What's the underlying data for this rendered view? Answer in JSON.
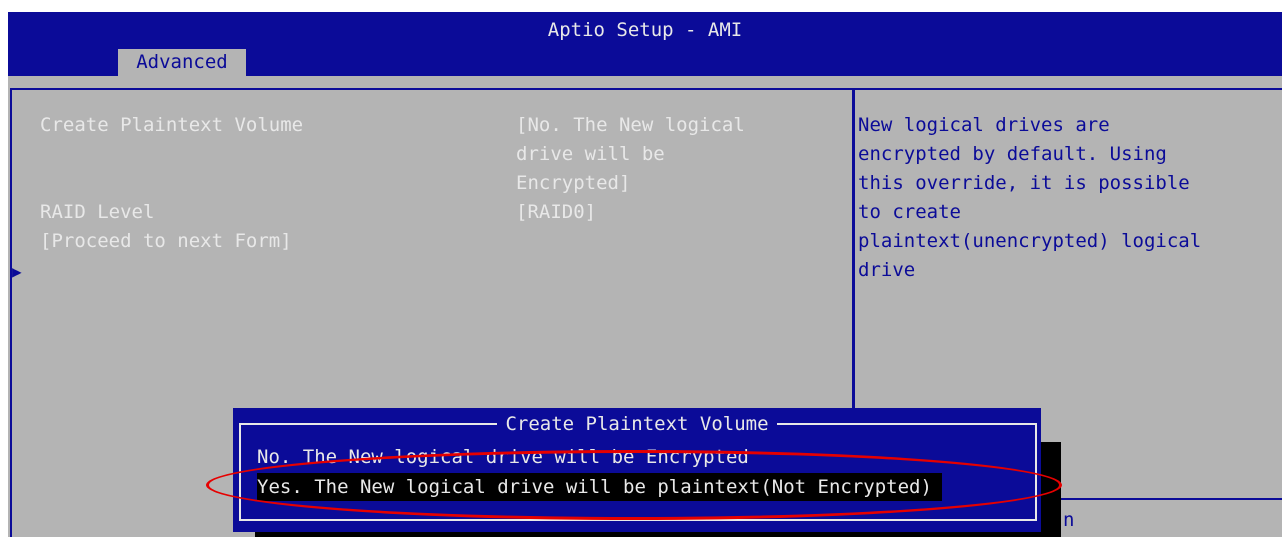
{
  "window": {
    "title": "Aptio Setup - AMI",
    "active_tab": "Advanced"
  },
  "settings": {
    "rows": [
      {
        "label": "Create Plaintext Volume",
        "value_lines": [
          "[No. The New logical",
          "drive will be",
          "Encrypted]"
        ]
      },
      {
        "label": "RAID Level",
        "value_lines": [
          "[RAID0]"
        ]
      },
      {
        "label": "[Proceed to next Form]",
        "value_lines": []
      }
    ]
  },
  "help": {
    "lines": [
      "New logical drives are",
      "encrypted by default. Using",
      "this override, it is possible",
      "to create",
      "plaintext(unencrypted) logical",
      "drive"
    ],
    "partial_text": "n"
  },
  "dialog": {
    "title": "Create Plaintext Volume",
    "options": [
      "No. The New logical drive will be Encrypted",
      "Yes. The New logical drive will be plaintext(Not Encrypted)"
    ],
    "selected_index": 1
  },
  "colors": {
    "header_bg": "#0b0b98",
    "body_bg": "#b4b4b4",
    "text_light": "#e8e8e8",
    "annotation": "#e60000"
  },
  "icons": {
    "submenu_marker": "triangle-right-icon"
  }
}
